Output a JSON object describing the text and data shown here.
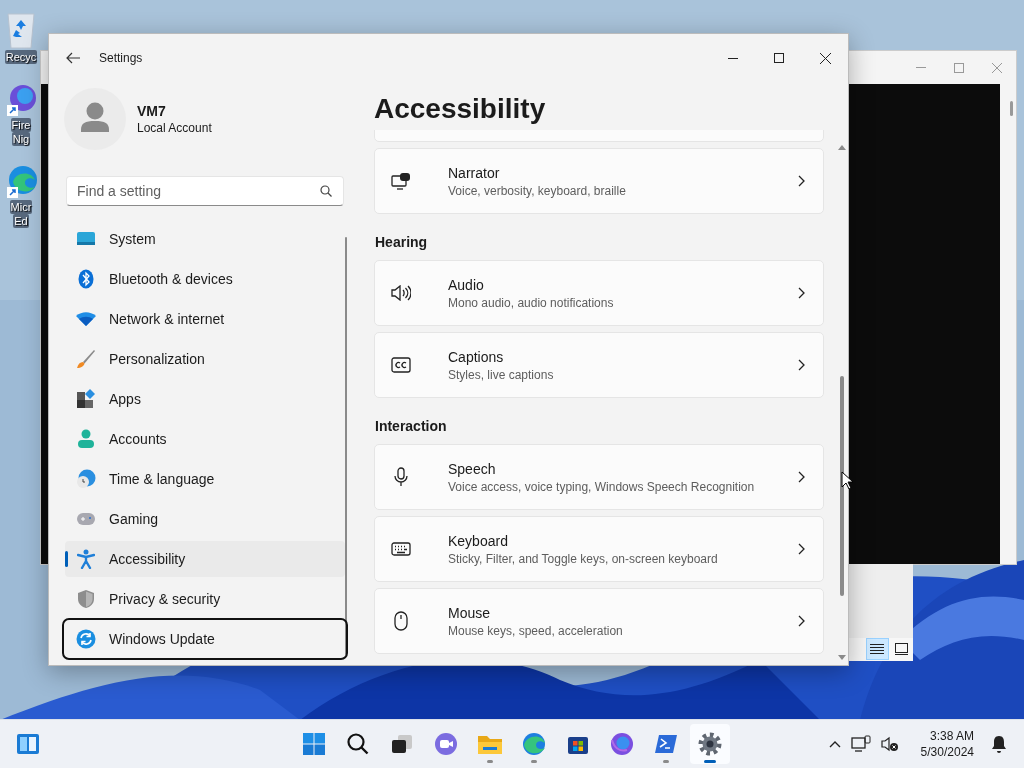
{
  "desktop": {
    "icons": [
      {
        "kind": "recycle",
        "lines": [
          "Recyc"
        ]
      },
      {
        "kind": "nightly",
        "lines": [
          "Fire",
          "Nig"
        ]
      },
      {
        "kind": "edge",
        "lines": [
          "Micr",
          "Ed"
        ]
      }
    ]
  },
  "background_window": {
    "view_buttons": [
      {
        "kind": "details",
        "selected": true
      },
      {
        "kind": "tiles",
        "selected": false
      }
    ]
  },
  "settings_window": {
    "title": "Settings",
    "profile": {
      "name": "VM7",
      "account": "Local Account"
    },
    "search": {
      "placeholder": "Find a setting"
    },
    "nav": [
      {
        "label": "System",
        "selected": false,
        "focused": false
      },
      {
        "label": "Bluetooth & devices",
        "selected": false,
        "focused": false
      },
      {
        "label": "Network & internet",
        "selected": false,
        "focused": false
      },
      {
        "label": "Personalization",
        "selected": false,
        "focused": false
      },
      {
        "label": "Apps",
        "selected": false,
        "focused": false
      },
      {
        "label": "Accounts",
        "selected": false,
        "focused": false
      },
      {
        "label": "Time & language",
        "selected": false,
        "focused": false
      },
      {
        "label": "Gaming",
        "selected": false,
        "focused": false
      },
      {
        "label": "Accessibility",
        "selected": true,
        "focused": false
      },
      {
        "label": "Privacy & security",
        "selected": false,
        "focused": false
      },
      {
        "label": "Windows Update",
        "selected": false,
        "focused": true
      }
    ],
    "page_title": "Accessibility",
    "groups": [
      {
        "cards": [
          {
            "title": "Narrator",
            "description": "Voice, verbosity, keyboard, braille"
          }
        ]
      },
      {
        "heading": "Hearing",
        "cards": [
          {
            "title": "Audio",
            "description": "Mono audio, audio notifications"
          },
          {
            "title": "Captions",
            "description": "Styles, live captions"
          }
        ]
      },
      {
        "heading": "Interaction",
        "cards": [
          {
            "title": "Speech",
            "description": "Voice access, voice typing, Windows Speech Recognition"
          },
          {
            "title": "Keyboard",
            "description": "Sticky, Filter, and Toggle keys, on-screen keyboard"
          },
          {
            "title": "Mouse",
            "description": "Mouse keys, speed, acceleration"
          }
        ]
      }
    ]
  },
  "taskbar": {
    "apps": [
      {
        "kind": "start",
        "running": false,
        "selected": false
      },
      {
        "kind": "search",
        "running": false,
        "selected": false
      },
      {
        "kind": "taskview",
        "running": false,
        "selected": false
      },
      {
        "kind": "chat",
        "running": false,
        "selected": false
      },
      {
        "kind": "folder",
        "running": true,
        "selected": false
      },
      {
        "kind": "edge",
        "running": true,
        "selected": false
      },
      {
        "kind": "store",
        "running": false,
        "selected": false
      },
      {
        "kind": "firefox",
        "running": false,
        "selected": false
      },
      {
        "kind": "terminal",
        "running": true,
        "selected": false
      },
      {
        "kind": "settings",
        "running": true,
        "selected": true
      }
    ],
    "clock": {
      "time": "3:38 AM",
      "date": "5/30/2024"
    }
  }
}
